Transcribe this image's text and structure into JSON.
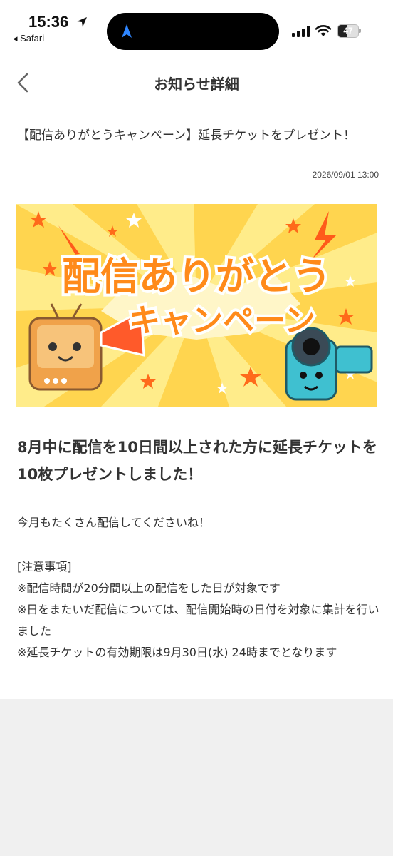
{
  "status_bar": {
    "time": "15:36",
    "back_app": "◂ Safari",
    "battery": "47",
    "battery_level": 0.47
  },
  "nav": {
    "title": "お知らせ詳細"
  },
  "notice": {
    "title": "【配信ありがとうキャンペーン】延長チケットをプレゼント！",
    "date": "2026/09/01 13:00"
  },
  "banner": {
    "line1": "配信ありがとう",
    "line2": "キャンペーン",
    "colors": {
      "bg": "#ffd54f",
      "ray": "#ffeb80",
      "text_fill": "#ff8a1a",
      "outline": "#ffffff",
      "star": "#ff6a1a"
    }
  },
  "content": {
    "headline": "8月中に配信を10日間以上された方に延長チケットを10枚プレゼントしました！",
    "message": "今月もたくさん配信してくださいね！",
    "notes_heading": "[注意事項]",
    "notes": [
      "※配信時間が20分間以上の配信をした日が対象です",
      "※日をまたいだ配信については、配信開始時の日付を対象に集計を行いました",
      "※延長チケットの有効期限は9月30日(水) 24時までとなります"
    ]
  }
}
